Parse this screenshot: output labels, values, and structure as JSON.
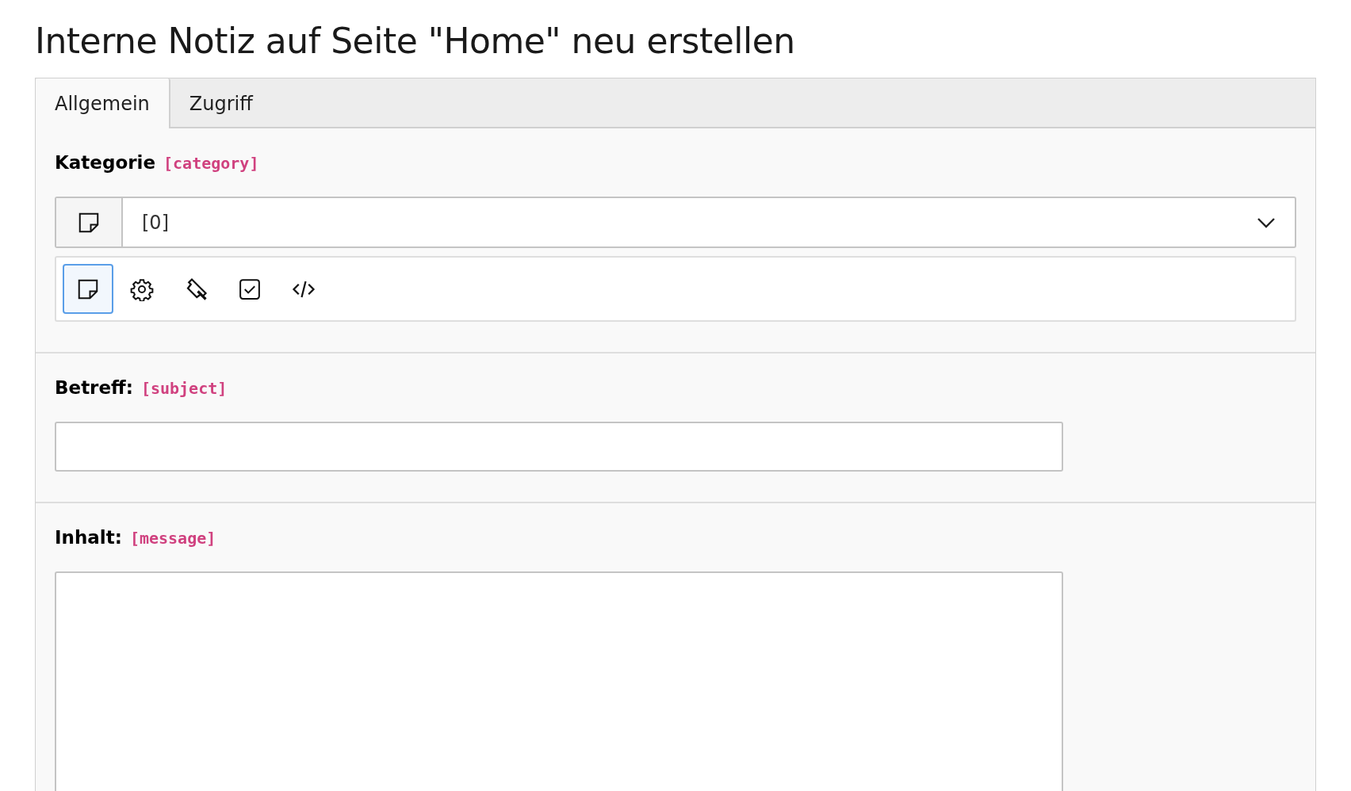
{
  "title": "Interne Notiz auf Seite \"Home\" neu erstellen",
  "tabs": [
    {
      "label": "Allgemein",
      "selected": true
    },
    {
      "label": "Zugriff",
      "selected": false
    }
  ],
  "sections": [
    {
      "kind": "select",
      "label": "Kategorie",
      "field_name": "[category]",
      "value": "[0]",
      "icons": [
        {
          "kind": "note",
          "selected": true
        },
        {
          "kind": "gear",
          "selected": false
        },
        {
          "kind": "pin",
          "selected": false
        },
        {
          "kind": "check",
          "selected": false
        },
        {
          "kind": "code",
          "selected": false
        }
      ]
    },
    {
      "kind": "input",
      "label": "Betreff:",
      "field_name": "[subject]"
    },
    {
      "kind": "textarea",
      "label": "Inhalt:",
      "field_name": "[message]"
    }
  ]
}
